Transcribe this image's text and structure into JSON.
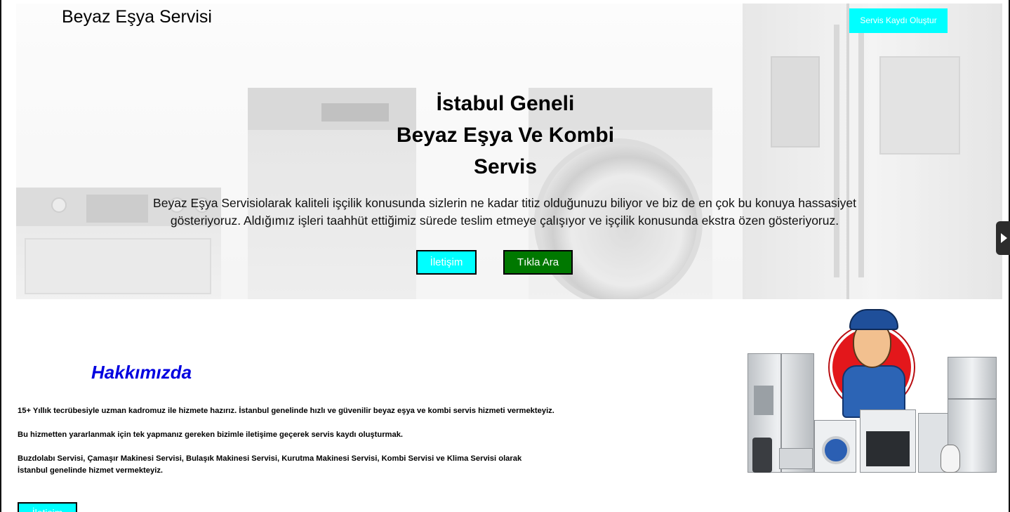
{
  "header": {
    "site_title": "Beyaz Eşya Servisi",
    "cta_label": "Servis Kaydı Oluştur"
  },
  "hero": {
    "heading_lines": [
      "İstabul Geneli",
      "Beyaz Eşya Ve Kombi",
      "Servis"
    ],
    "text": "Beyaz Eşya Servisiolarak kaliteli işçilik konusunda sizlerin ne kadar titiz olduğunuzu biliyor ve biz de en çok bu konuya hassasiyet gösteriyoruz. Aldığımız işleri taahhüt ettiğimiz sürede teslim etmeye çalışıyor ve işçilik konusunda ekstra özen gösteriyoruz.",
    "contact_button": "İletişim",
    "call_button": "Tıkla Ara"
  },
  "about": {
    "title": "Hakkımızda",
    "p1": "15+ Yıllık tecrübesiyle uzman kadromuz ile hizmete hazırız. İstanbul genelinde hızlı ve güvenilir beyaz eşya ve kombi servis hizmeti vermekteyiz.",
    "p2": "Bu hizmetten yararlanmak için tek yapmanız gereken bizimle iletişime geçerek servis kaydı oluşturmak.",
    "p3": "Buzdolabı Servisi, Çamaşır Makinesi Servisi, Bulaşık Makinesi Servisi, Kurutma Makinesi Servisi, Kombi Servisi ve Klima Servisi olarak İstanbul genelinde hizmet vermekteyiz.",
    "button": "İletişim"
  },
  "colors": {
    "accent_cyan": "#00ffff",
    "call_green": "#007800",
    "about_title_blue": "#0000e0"
  },
  "icons": {
    "carousel_next": "chevron-right-icon"
  }
}
